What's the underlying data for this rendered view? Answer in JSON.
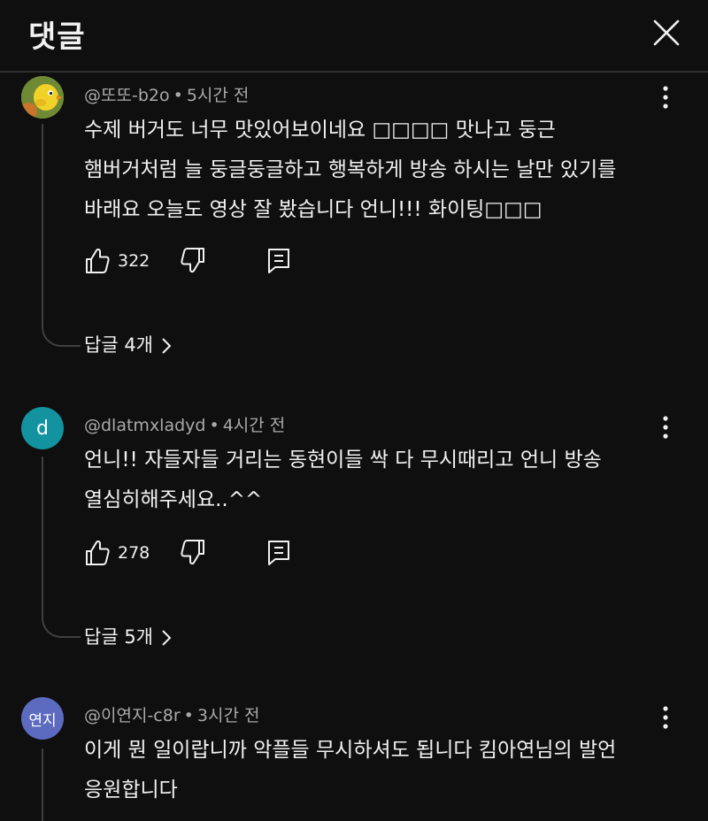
{
  "header": {
    "title": "댓글",
    "close_icon": "close-icon"
  },
  "comments": [
    {
      "author": "@또또-b2o",
      "time": "5시간 전",
      "text_line1": "수제 버거도 너무 맛있어보이네요 □□□□ 맛나고 둥근",
      "text_line2": "햄버거처럼 늘 둥글둥글하고 행복하게 방송 하시는 날만 있기를",
      "text_line3": "바래요 오늘도 영상 잘 봤습니다 언니!!! 화이팅□□□",
      "likes": "322",
      "replies": "답글 4개",
      "avatar_icon": "yellow-bird-avatar"
    },
    {
      "author": "@dlatmxladyd",
      "time": "4시간 전",
      "text_line1": "언니!! 자들자들 거리는 동현이들 싹 다 무시때리고 언니 방송",
      "text_line2": "열심히해주세요..^^",
      "likes": "278",
      "replies": "답글 5개",
      "avatar_letter": "d",
      "avatar_color": "#12939f"
    },
    {
      "author": "@이연지-c8r",
      "time": "3시간 전",
      "text_line1": "이게 뭔 일이랍니까 악플들 무시하셔도 됩니다 킴아연님의 발언",
      "text_line2": "응원합니다",
      "avatar_text": "연지",
      "avatar_color": "#5c6bc0"
    }
  ],
  "icons": {
    "like": "thumbs-up-icon",
    "dislike": "thumbs-down-icon",
    "reply": "reply-icon",
    "more": "more-vertical-icon",
    "expand": "chevron-right-icon"
  }
}
